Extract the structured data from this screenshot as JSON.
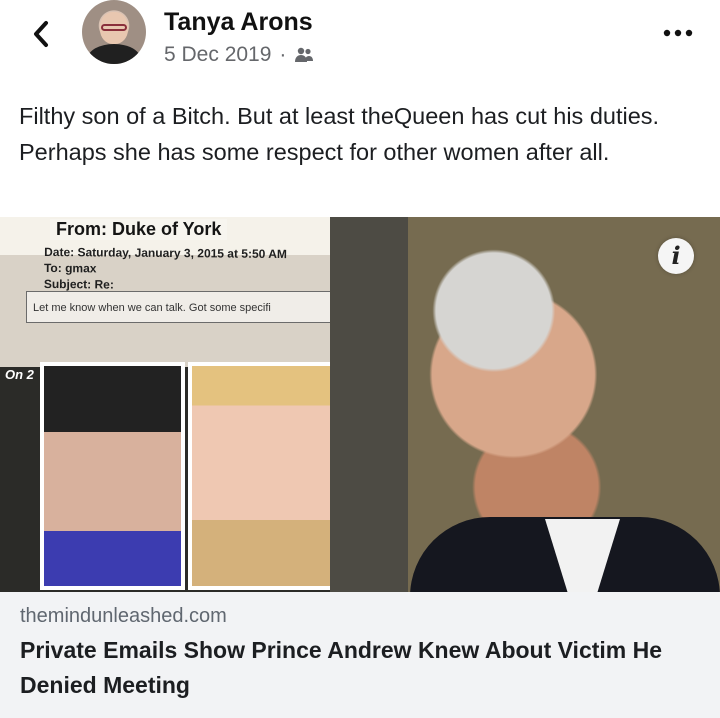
{
  "post": {
    "author": "Tanya Arons",
    "date": "5 Dec 2019",
    "separator": "·",
    "audience_icon": "friends-icon",
    "text": "Filthy son of a Bitch.  But at least theQueen has cut his duties. Perhaps she has some respect for other women after all."
  },
  "media": {
    "email_from": "From: Duke of York",
    "email_date": "Date: Saturday, January 3, 2015 at 5:50 AM",
    "email_to": "To: gmax",
    "email_subject": "Subject: Re:",
    "email_body": "Let me know when we can talk. Got some specifi",
    "on_label": "On 2",
    "info_icon": "info-icon"
  },
  "link": {
    "domain": "themindunleashed.com",
    "headline": "Private Emails Show Prince Andrew Knew About Victim He Denied Meeting"
  },
  "colors": {
    "link_background": "#f2f3f5",
    "muted_text": "#65676b",
    "info_button": "#f5f5f5"
  }
}
